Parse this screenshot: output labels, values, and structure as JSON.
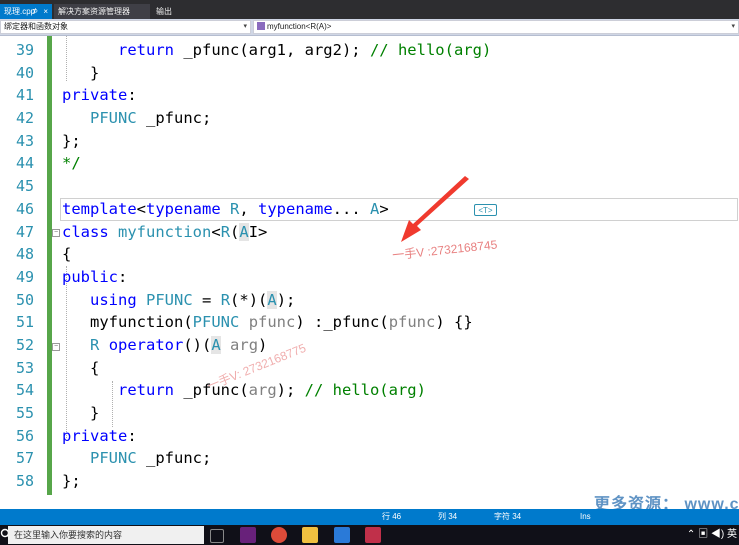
{
  "tabs": {
    "active_file": "现理.cpp",
    "pin": "⊅",
    "close": "×",
    "solution_explorer": "解决方案资源管理器",
    "output": "输出"
  },
  "navbar": {
    "scope": "绑定器和函数对象",
    "member": "myfunction<R(A)>"
  },
  "editor": {
    "line_numbers": [
      "39",
      "40",
      "41",
      "42",
      "43",
      "44",
      "45",
      "46",
      "47",
      "48",
      "49",
      "50",
      "51",
      "52",
      "53",
      "54",
      "55",
      "56",
      "57",
      "58"
    ],
    "current_line_template_badge": "<T>"
  },
  "watermarks": {
    "contact": "一手V :2732168745",
    "contact_faint": "一手V: 2732168775",
    "corner": "更多资源： www.c"
  },
  "status": {
    "line": "行 46",
    "column": "列 34",
    "char": "字符 34",
    "mode": "Ins"
  },
  "taskbar": {
    "search_placeholder": "在这里输入你要搜索的内容",
    "ime": "英"
  },
  "colors": {
    "keyword": "#0000ff",
    "type": "#2b91af",
    "comment": "#008000",
    "accent": "#007acc"
  }
}
